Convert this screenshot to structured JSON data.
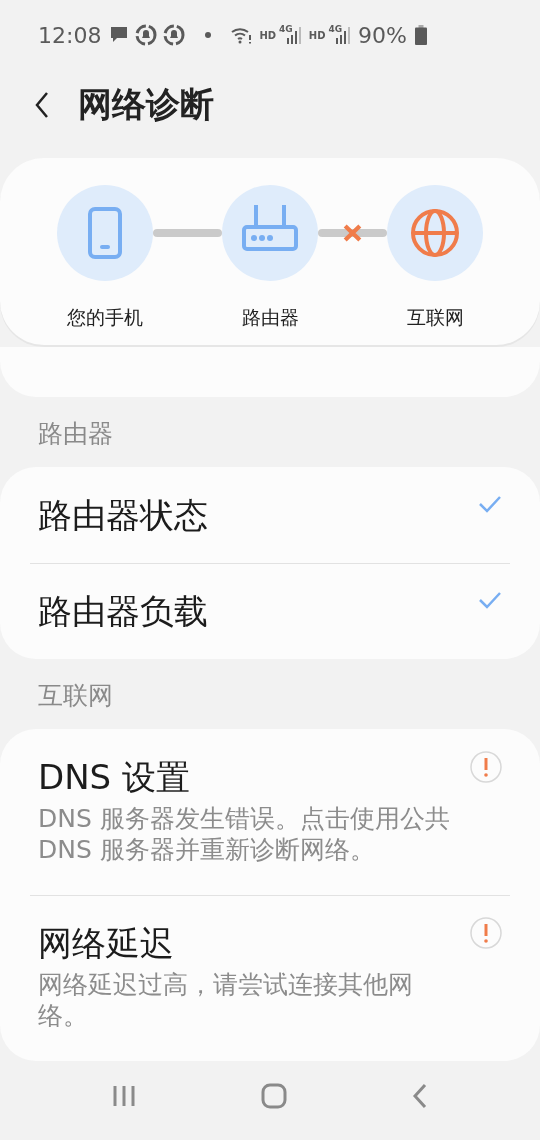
{
  "status_bar": {
    "time": "12:08",
    "sims": [
      {
        "hd": "HD",
        "network": "4G"
      },
      {
        "hd": "HD",
        "network": "4G"
      }
    ],
    "battery": "90%"
  },
  "header": {
    "title": "网络诊断"
  },
  "diagram": {
    "nodes": [
      {
        "kind": "phone",
        "label": "您的手机",
        "color": "#78aef2"
      },
      {
        "kind": "router",
        "label": "路由器",
        "color": "#78aef2"
      },
      {
        "kind": "globe",
        "label": "互联网",
        "color": "#f07c4a"
      }
    ],
    "links": [
      {
        "connected": true
      },
      {
        "connected": false
      }
    ]
  },
  "sections": [
    {
      "header": "路由器",
      "items": [
        {
          "title": "路由器状态",
          "passed": true
        },
        {
          "title": "路由器负载",
          "passed": true
        }
      ]
    },
    {
      "header": "互联网",
      "items": [
        {
          "title": "DNS 设置",
          "description": "DNS 服务器发生错误。点击使用公共 DNS 服务器并重新诊断网络。",
          "passed": false
        },
        {
          "title": "网络延迟",
          "description": "网络延迟过高，请尝试连接其他网络。",
          "passed": false
        }
      ]
    }
  ]
}
